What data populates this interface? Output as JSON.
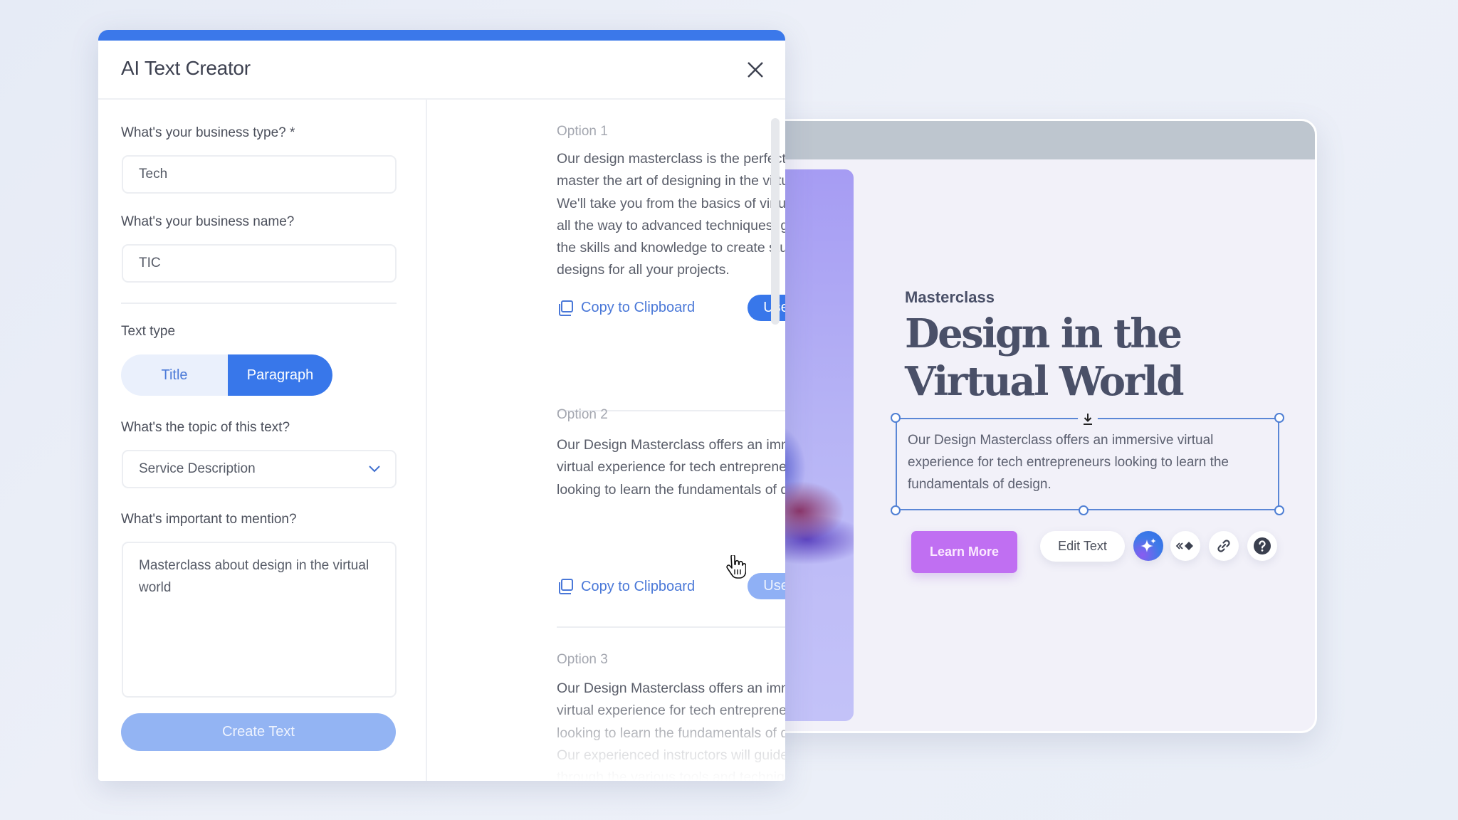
{
  "modal": {
    "title": "AI Text Creator",
    "accent_color": "#3877ea",
    "close_icon": "close-icon"
  },
  "form": {
    "business_type": {
      "label": "What's your business type? *",
      "value": "Tech"
    },
    "business_name": {
      "label": "What's your business name?",
      "value": "TIC"
    },
    "text_type": {
      "label": "Text type",
      "options": [
        "Title",
        "Paragraph"
      ],
      "selected": "Paragraph"
    },
    "topic": {
      "label": "What's the topic of this text?",
      "value": "Service Description",
      "icon": "chevron-down-icon"
    },
    "mention": {
      "label": "What's important to mention?",
      "value": "Masterclass about design in the virtual world"
    },
    "create_button": "Create Text"
  },
  "options": [
    {
      "label": "Option 1",
      "text": "Our design masterclass is the perfect way to master the art of designing in the virtual world. We'll take you from the basics of virtual design all the way to advanced techniques, giving you the skills and knowledge to create stunning designs for all your projects.",
      "copy_label": "Copy to Clipboard",
      "use_label": "Use Text"
    },
    {
      "label": "Option 2",
      "text": "Our Design Masterclass offers an immersive virtual experience for tech entrepreneurs looking to learn the fundamentals of design.",
      "copy_label": "Copy to Clipboard",
      "use_label": "Use Text",
      "state": "hover"
    },
    {
      "label": "Option 3",
      "text": "Our Design Masterclass offers an immersive virtual experience for tech entrepreneurs looking to learn the fundamentals of design. Our experienced instructors will guide you through the various tools and techniques"
    }
  ],
  "editor": {
    "eyebrow": "Masterclass",
    "title": "Design in the Virtual World",
    "selected_text": "Our Design Masterclass offers an immersive virtual experience for tech entrepreneurs looking to learn the fundamentals of design.",
    "learn_more": "Learn More",
    "button_color": "#c06ff2",
    "toolbar": {
      "edit_text": "Edit Text",
      "icons": [
        "ai-sparkle-icon",
        "animation-icon",
        "link-icon",
        "help-icon"
      ]
    }
  }
}
